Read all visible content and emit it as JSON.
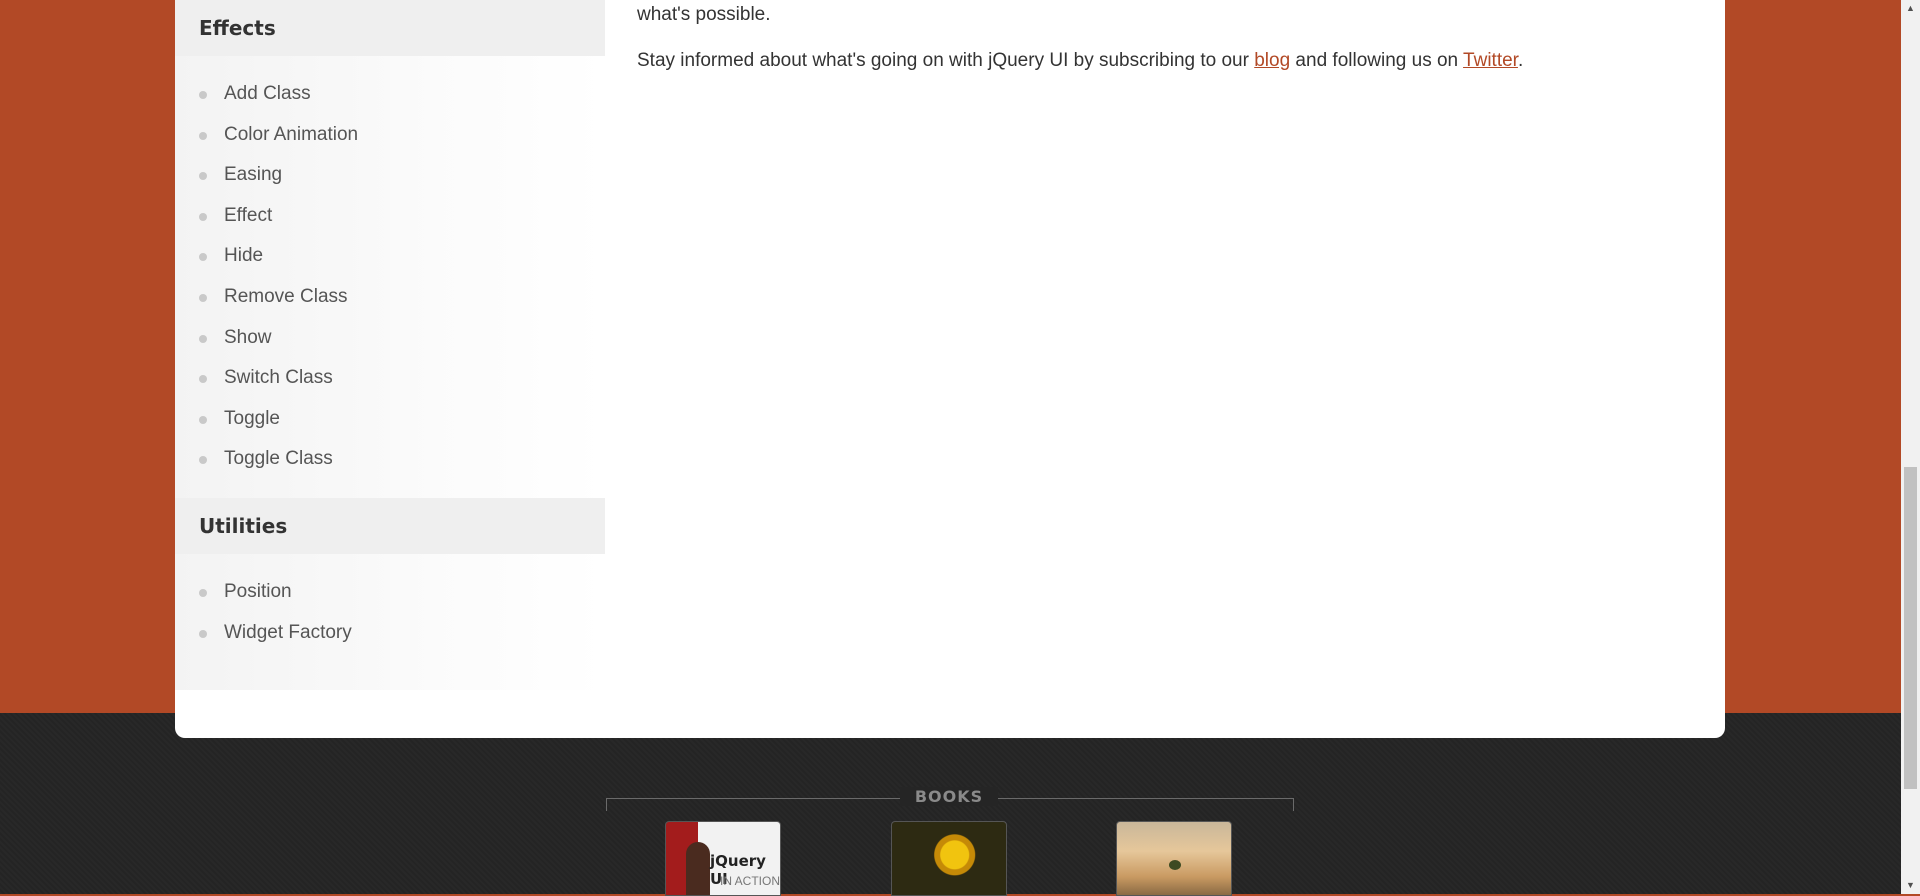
{
  "sidebar": {
    "sections": [
      {
        "title": "Effects",
        "items": [
          "Add Class",
          "Color Animation",
          "Easing",
          "Effect",
          "Hide",
          "Remove Class",
          "Show",
          "Switch Class",
          "Toggle",
          "Toggle Class"
        ]
      },
      {
        "title": "Utilities",
        "items": [
          "Position",
          "Widget Factory"
        ]
      }
    ]
  },
  "main": {
    "line1": "what's possible.",
    "line2_prefix": "Stay informed about what's going on with jQuery UI by subscribing to our ",
    "blog_link": "blog",
    "line2_middle": " and following us on ",
    "twitter_link": "Twitter",
    "line2_suffix": "."
  },
  "footer": {
    "books_heading": "BOOKS",
    "books": [
      {
        "cover_title": "jQuery UI",
        "cover_subtitle": "IN ACTION"
      },
      {},
      {}
    ]
  },
  "colors": {
    "accent": "#b24926",
    "footer_bg": "#252525"
  }
}
